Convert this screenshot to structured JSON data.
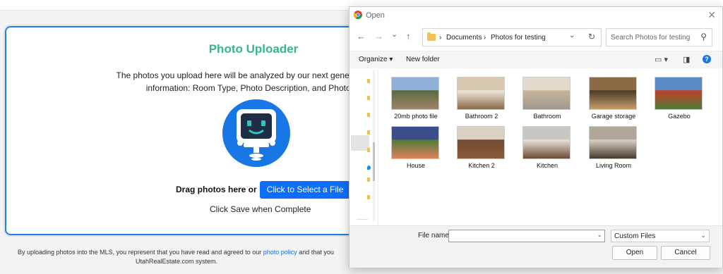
{
  "uploader": {
    "title": "Photo Uploader",
    "desc_line1": "The photos you upload here will be analyzed by our next generation software",
    "desc_line2": "information: Room Type, Photo Description, and Photo Searc",
    "drag_text": "Drag photos here or",
    "select_button": "Click to Select a File",
    "save_hint": "Click Save when Complete",
    "accent_color": "#37b68a",
    "button_color": "#0d6efd"
  },
  "footer": {
    "prefix": "By uploading photos into the MLS, you represent that you have read and agreed to our ",
    "link": "photo policy",
    "suffix": " and that you",
    "line2": "UtahRealEstate.com system."
  },
  "dialog": {
    "title": "Open",
    "close": "✕",
    "nav": {
      "back": "←",
      "forward": "→",
      "recent": "⌄",
      "up": "↑"
    },
    "path": [
      "Documents",
      "Photos for testing"
    ],
    "path_sep": "›",
    "search_placeholder": "Search Photos for testing",
    "toolbar": {
      "organize": "Organize ▾",
      "new_folder": "New folder",
      "help": "?"
    },
    "files": [
      {
        "name": "20mb photo file",
        "colors": [
          "#8fb0d8",
          "#a1836a",
          "#5a6b3e"
        ]
      },
      {
        "name": "Bathroom 2",
        "colors": [
          "#d8c8b0",
          "#8a6a4a",
          "#f0e8dc"
        ]
      },
      {
        "name": "Bathroom",
        "colors": [
          "#e2dccf",
          "#9f9a90",
          "#c8b49a"
        ]
      },
      {
        "name": "Garage storage",
        "colors": [
          "#8c6a44",
          "#c49d6a",
          "#4a3a2a"
        ]
      },
      {
        "name": "Gazebo",
        "colors": [
          "#5a8ac8",
          "#4f7a3a",
          "#c33f2a"
        ]
      },
      {
        "name": "House",
        "colors": [
          "#3b4d8a",
          "#e0825a",
          "#4e7a3a"
        ]
      },
      {
        "name": "Kitchen 2",
        "colors": [
          "#d9d2c4",
          "#8b5a3a",
          "#6f4b30"
        ]
      },
      {
        "name": "Kitchen",
        "colors": [
          "#c9c7c2",
          "#6d4a33",
          "#e8e4dc"
        ]
      },
      {
        "name": "Living Room",
        "colors": [
          "#b0a898",
          "#4a3a2e",
          "#d8d2c8"
        ]
      }
    ],
    "file_name_label": "File name:",
    "file_name_value": "",
    "file_type": "Custom Files",
    "open_button": "Open",
    "cancel_button": "Cancel"
  }
}
